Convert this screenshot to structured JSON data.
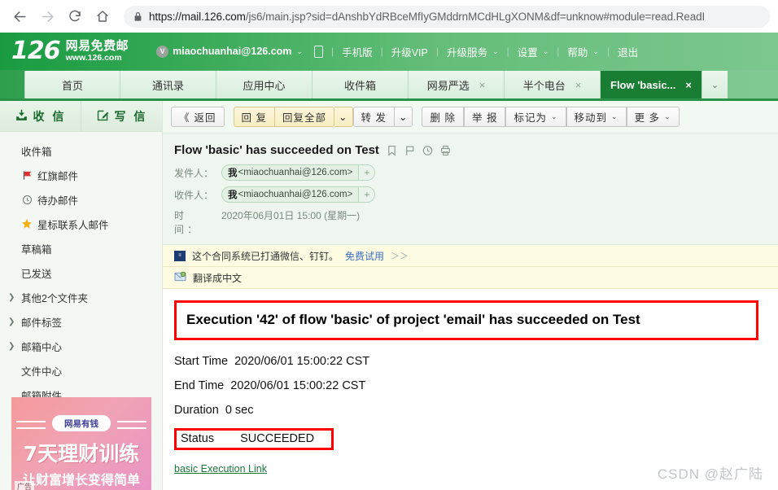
{
  "browser": {
    "back_icon": "back-arrow-icon",
    "forward_icon": "forward-arrow-icon",
    "reload_icon": "reload-icon",
    "home_icon": "home-icon",
    "lock_icon": "lock-icon",
    "url_host": "https://mail.126.com",
    "url_path": "/js6/main.jsp?sid=dAnshbYdRBceMfIyGMddrnMCdHLgXONM&df=unknow#module=read.ReadI"
  },
  "header": {
    "logo_number": "126",
    "logo_cn": "网易免费邮",
    "logo_url": "www.126.com",
    "avatar_letter": "V",
    "user_email": "miaochuanhai@126.com",
    "links": [
      "手机版",
      "升级VIP",
      "升级服务",
      "设置",
      "帮助",
      "退出"
    ],
    "links_with_caret": [
      "升级服务",
      "设置",
      "帮助"
    ]
  },
  "tabs": [
    {
      "label": "首页",
      "closable": false,
      "active": false
    },
    {
      "label": "通讯录",
      "closable": false,
      "active": false
    },
    {
      "label": "应用中心",
      "closable": false,
      "active": false
    },
    {
      "label": "收件箱",
      "closable": false,
      "active": false
    },
    {
      "label": "网易严选",
      "closable": true,
      "active": false
    },
    {
      "label": "半个电台",
      "closable": true,
      "active": false
    },
    {
      "label": "Flow 'basic...",
      "closable": true,
      "active": true
    }
  ],
  "tab_close_glyph": "×",
  "tab_overflow_glyph": "⌄",
  "sidebar": {
    "receive_label": "收 信",
    "compose_label": "写 信",
    "receive_icon": "inbox-download-icon",
    "compose_icon": "compose-pencil-icon",
    "items": [
      {
        "label": "收件箱",
        "icon": "",
        "chevron": false
      },
      {
        "label": "红旗邮件",
        "icon": "red-flag-icon",
        "chevron": false
      },
      {
        "label": "待办邮件",
        "icon": "clock-icon",
        "chevron": false
      },
      {
        "label": "星标联系人邮件",
        "icon": "star-icon",
        "chevron": false
      },
      {
        "label": "草稿箱",
        "icon": "",
        "chevron": false
      },
      {
        "label": "已发送",
        "icon": "",
        "chevron": false
      },
      {
        "label": "其他2个文件夹",
        "icon": "",
        "chevron": true
      },
      {
        "label": "邮件标签",
        "icon": "",
        "chevron": true
      },
      {
        "label": "邮箱中心",
        "icon": "",
        "chevron": true
      },
      {
        "label": "文件中心",
        "icon": "",
        "chevron": false
      },
      {
        "label": "邮箱附件",
        "icon": "",
        "chevron": false
      }
    ],
    "ad": {
      "pill": "网易有钱",
      "line1": "7天理财训练",
      "line2": "让财富增长变得简单",
      "tag": "广告"
    }
  },
  "toolbar": {
    "back_label": "返回",
    "back_glyph": "《",
    "reply_label": "回 复",
    "reply_all_label": "回复全部",
    "forward_label": "转 发",
    "delete_label": "删 除",
    "report_label": "举 报",
    "mark_as_label": "标记为",
    "move_to_label": "移动到",
    "more_label": "更 多",
    "caret_glyph": "⌄"
  },
  "mail": {
    "subject": "Flow 'basic' has succeeded on Test",
    "subject_icons": [
      "bookmark-icon",
      "flag-icon",
      "clock-icon",
      "print-icon"
    ],
    "from_label": "发件人：",
    "to_label": "收件人：",
    "time_label": "时　间：",
    "from_chip_name": "我",
    "from_chip_addr": "<miaochuanhai@126.com>",
    "to_chip_name": "我",
    "to_chip_addr": "<miaochuanhai@126.com>",
    "chip_plus": "+",
    "date": "2020年06月01日 15:00 (星期一)"
  },
  "notices": [
    {
      "icon": "blue-square-ad-icon",
      "text": "这个合同系统已打通微信、钉钉。",
      "link": "免费试用",
      "arrows": "＞＞"
    },
    {
      "icon": "translate-icon",
      "text": "翻译成中文",
      "link": "",
      "arrows": ""
    }
  ],
  "body": {
    "headline": "Execution '42' of flow 'basic' of project 'email' has succeeded on Test",
    "rows": [
      {
        "key": "Start Time",
        "value": "2020/06/01 15:00:22 CST",
        "boxed": false
      },
      {
        "key": "End Time",
        "value": "2020/06/01 15:00:22 CST",
        "boxed": false
      },
      {
        "key": "Duration",
        "value": "0 sec",
        "boxed": false
      },
      {
        "key": "Status",
        "value": "SUCCEEDED",
        "boxed": true
      }
    ],
    "link": "basic Execution Link"
  },
  "watermark": "CSDN @赵广陆",
  "colors": {
    "brand_green": "#2a9247",
    "active_tab_green": "#197d33",
    "alert_red": "#ff0000",
    "notice_yellow": "#fdfce3",
    "link_blue": "#3b6fc4",
    "link_green": "#1a7a3a"
  }
}
